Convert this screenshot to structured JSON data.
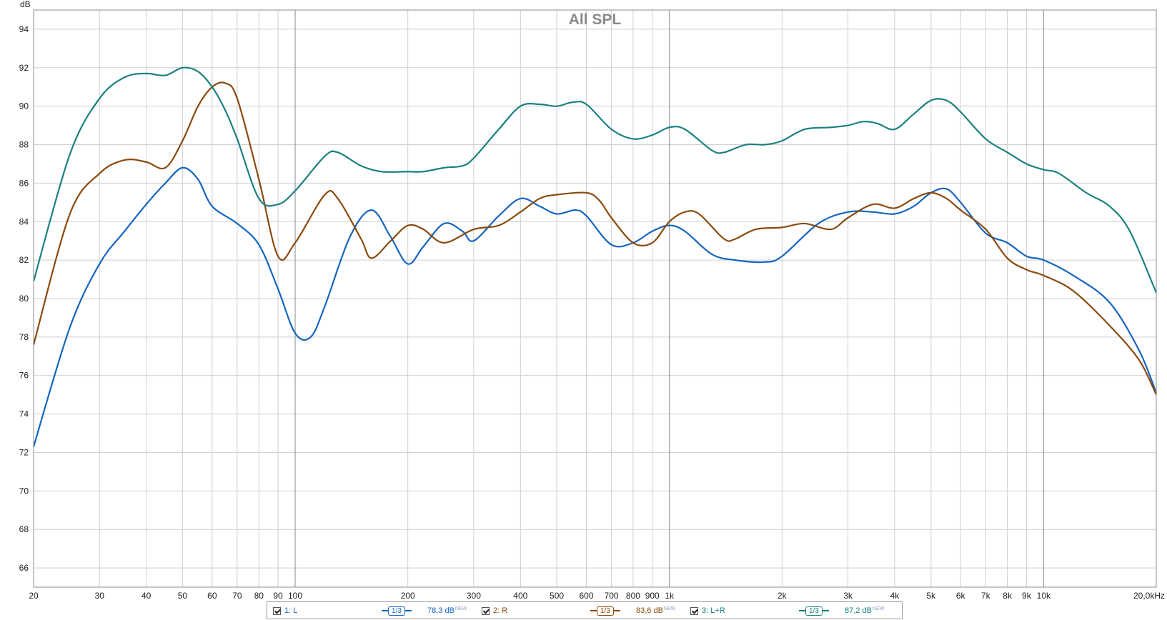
{
  "chart_data": {
    "type": "line",
    "title": "All SPL",
    "ylabel": "dB",
    "xscale": "log",
    "xlim": [
      20,
      20000
    ],
    "ylim": [
      65,
      95
    ],
    "y_ticks": [
      66,
      68,
      70,
      72,
      74,
      76,
      78,
      80,
      82,
      84,
      86,
      88,
      90,
      92,
      94
    ],
    "x_ticks": [
      {
        "v": 20,
        "label": "20"
      },
      {
        "v": 30,
        "label": "30"
      },
      {
        "v": 40,
        "label": "40"
      },
      {
        "v": 50,
        "label": "50"
      },
      {
        "v": 60,
        "label": "60"
      },
      {
        "v": 70,
        "label": "70"
      },
      {
        "v": 80,
        "label": "80"
      },
      {
        "v": 90,
        "label": "90"
      },
      {
        "v": 100,
        "label": "100"
      },
      {
        "v": 200,
        "label": "200"
      },
      {
        "v": 300,
        "label": "300"
      },
      {
        "v": 400,
        "label": "400"
      },
      {
        "v": 500,
        "label": "500"
      },
      {
        "v": 600,
        "label": "600"
      },
      {
        "v": 700,
        "label": "700"
      },
      {
        "v": 800,
        "label": "800"
      },
      {
        "v": 900,
        "label": "900"
      },
      {
        "v": 1000,
        "label": "1k"
      },
      {
        "v": 2000,
        "label": "2k"
      },
      {
        "v": 3000,
        "label": "3k"
      },
      {
        "v": 4000,
        "label": "4k"
      },
      {
        "v": 5000,
        "label": "5k"
      },
      {
        "v": 6000,
        "label": "6k"
      },
      {
        "v": 7000,
        "label": "7k"
      },
      {
        "v": 8000,
        "label": "8k"
      },
      {
        "v": 9000,
        "label": "9k"
      },
      {
        "v": 10000,
        "label": "10k"
      },
      {
        "v": 20000,
        "label": "20,0kHz"
      }
    ],
    "grid": true,
    "series": [
      {
        "name": "1: L",
        "color": "#1565c0",
        "points": [
          [
            20,
            72.3
          ],
          [
            25,
            78.5
          ],
          [
            30,
            81.8
          ],
          [
            35,
            83.5
          ],
          [
            40,
            84.9
          ],
          [
            45,
            86.0
          ],
          [
            50,
            86.8
          ],
          [
            55,
            86.2
          ],
          [
            60,
            84.8
          ],
          [
            70,
            83.9
          ],
          [
            80,
            82.8
          ],
          [
            90,
            80.5
          ],
          [
            100,
            78.2
          ],
          [
            110,
            78.0
          ],
          [
            120,
            79.6
          ],
          [
            140,
            83.2
          ],
          [
            160,
            84.6
          ],
          [
            180,
            83.2
          ],
          [
            200,
            81.8
          ],
          [
            220,
            82.7
          ],
          [
            250,
            83.9
          ],
          [
            280,
            83.5
          ],
          [
            300,
            83.0
          ],
          [
            350,
            84.3
          ],
          [
            400,
            85.2
          ],
          [
            450,
            84.8
          ],
          [
            500,
            84.4
          ],
          [
            560,
            84.6
          ],
          [
            600,
            84.3
          ],
          [
            700,
            82.8
          ],
          [
            800,
            82.9
          ],
          [
            900,
            83.5
          ],
          [
            1000,
            83.8
          ],
          [
            1100,
            83.5
          ],
          [
            1300,
            82.3
          ],
          [
            1500,
            82.0
          ],
          [
            1800,
            81.9
          ],
          [
            2000,
            82.2
          ],
          [
            2500,
            83.9
          ],
          [
            3000,
            84.5
          ],
          [
            3500,
            84.5
          ],
          [
            4000,
            84.4
          ],
          [
            4500,
            84.8
          ],
          [
            5000,
            85.5
          ],
          [
            5500,
            85.7
          ],
          [
            6000,
            85.0
          ],
          [
            7000,
            83.4
          ],
          [
            8000,
            82.9
          ],
          [
            9000,
            82.2
          ],
          [
            10000,
            82.0
          ],
          [
            12000,
            81.2
          ],
          [
            15000,
            79.8
          ],
          [
            18000,
            77.3
          ],
          [
            20000,
            75.1
          ]
        ]
      },
      {
        "name": "2: R",
        "color": "#8a4a0e",
        "points": [
          [
            20,
            77.6
          ],
          [
            25,
            84.4
          ],
          [
            30,
            86.5
          ],
          [
            35,
            87.2
          ],
          [
            40,
            87.1
          ],
          [
            45,
            86.8
          ],
          [
            50,
            88.2
          ],
          [
            55,
            90.0
          ],
          [
            60,
            91.0
          ],
          [
            65,
            91.2
          ],
          [
            70,
            90.4
          ],
          [
            80,
            86.2
          ],
          [
            90,
            82.2
          ],
          [
            100,
            82.9
          ],
          [
            120,
            85.4
          ],
          [
            130,
            85.2
          ],
          [
            150,
            83.1
          ],
          [
            160,
            82.1
          ],
          [
            180,
            83.0
          ],
          [
            200,
            83.8
          ],
          [
            220,
            83.6
          ],
          [
            250,
            82.9
          ],
          [
            300,
            83.6
          ],
          [
            350,
            83.8
          ],
          [
            400,
            84.5
          ],
          [
            450,
            85.2
          ],
          [
            500,
            85.4
          ],
          [
            600,
            85.5
          ],
          [
            650,
            85.1
          ],
          [
            700,
            84.2
          ],
          [
            800,
            82.9
          ],
          [
            900,
            82.9
          ],
          [
            1000,
            84.0
          ],
          [
            1100,
            84.5
          ],
          [
            1200,
            84.4
          ],
          [
            1400,
            83.1
          ],
          [
            1500,
            83.1
          ],
          [
            1700,
            83.6
          ],
          [
            2000,
            83.7
          ],
          [
            2300,
            83.9
          ],
          [
            2700,
            83.6
          ],
          [
            3000,
            84.2
          ],
          [
            3500,
            84.9
          ],
          [
            4000,
            84.7
          ],
          [
            4500,
            85.2
          ],
          [
            5000,
            85.5
          ],
          [
            5500,
            85.2
          ],
          [
            6000,
            84.6
          ],
          [
            7000,
            83.6
          ],
          [
            8000,
            82.1
          ],
          [
            9000,
            81.5
          ],
          [
            10000,
            81.2
          ],
          [
            12000,
            80.4
          ],
          [
            15000,
            78.6
          ],
          [
            18000,
            76.8
          ],
          [
            20000,
            75.0
          ]
        ]
      },
      {
        "name": "3: L+R",
        "color": "#1a8080",
        "points": [
          [
            20,
            80.9
          ],
          [
            25,
            87.5
          ],
          [
            30,
            90.4
          ],
          [
            35,
            91.5
          ],
          [
            40,
            91.7
          ],
          [
            45,
            91.6
          ],
          [
            50,
            92.0
          ],
          [
            55,
            91.8
          ],
          [
            60,
            91.0
          ],
          [
            65,
            89.8
          ],
          [
            70,
            88.3
          ],
          [
            80,
            85.2
          ],
          [
            90,
            84.9
          ],
          [
            100,
            85.6
          ],
          [
            120,
            87.4
          ],
          [
            130,
            87.6
          ],
          [
            150,
            86.9
          ],
          [
            170,
            86.6
          ],
          [
            200,
            86.6
          ],
          [
            220,
            86.6
          ],
          [
            250,
            86.8
          ],
          [
            280,
            86.9
          ],
          [
            300,
            87.3
          ],
          [
            350,
            88.8
          ],
          [
            400,
            90.0
          ],
          [
            450,
            90.1
          ],
          [
            500,
            90.0
          ],
          [
            550,
            90.2
          ],
          [
            600,
            90.1
          ],
          [
            700,
            88.8
          ],
          [
            800,
            88.3
          ],
          [
            900,
            88.5
          ],
          [
            1000,
            88.9
          ],
          [
            1100,
            88.8
          ],
          [
            1300,
            87.7
          ],
          [
            1400,
            87.6
          ],
          [
            1600,
            88.0
          ],
          [
            1800,
            88.0
          ],
          [
            2000,
            88.2
          ],
          [
            2300,
            88.8
          ],
          [
            2700,
            88.9
          ],
          [
            3000,
            89.0
          ],
          [
            3300,
            89.2
          ],
          [
            3600,
            89.1
          ],
          [
            4000,
            88.8
          ],
          [
            4500,
            89.6
          ],
          [
            5000,
            90.3
          ],
          [
            5500,
            90.3
          ],
          [
            6000,
            89.7
          ],
          [
            7000,
            88.3
          ],
          [
            8000,
            87.6
          ],
          [
            9000,
            87.0
          ],
          [
            10000,
            86.7
          ],
          [
            11000,
            86.5
          ],
          [
            13000,
            85.5
          ],
          [
            15000,
            84.8
          ],
          [
            17000,
            83.5
          ],
          [
            20000,
            80.3
          ]
        ]
      }
    ]
  },
  "legend": [
    {
      "label": "1: L",
      "smoothing": "1/3",
      "level": "78,3 dB",
      "tag": "NEW",
      "color": "#1565c0"
    },
    {
      "label": "2: R",
      "smoothing": "1/3",
      "level": "83,6 dB",
      "tag": "NEW",
      "color": "#8a4a0e"
    },
    {
      "label": "3: L+R",
      "smoothing": "1/3",
      "level": "87,2 dB",
      "tag": "NEW",
      "color": "#1a8080"
    }
  ]
}
